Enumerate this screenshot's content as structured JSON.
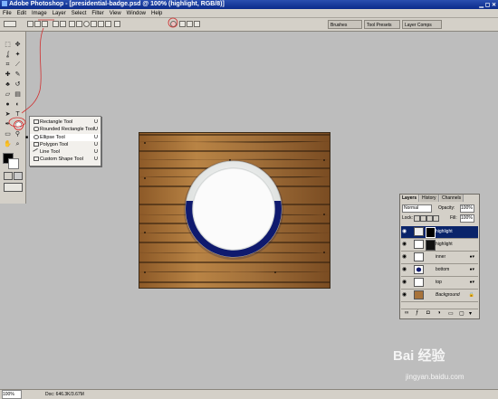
{
  "window": {
    "title": "Adobe Photoshop - [presidential-badge.psd @ 100% (highlight, RGB/8)]"
  },
  "menu": [
    "File",
    "Edit",
    "Image",
    "Layer",
    "Select",
    "Filter",
    "View",
    "Window",
    "Help"
  ],
  "options": {
    "palette_tabs": [
      "Brushes",
      "Tool Presets",
      "Layer Comps"
    ]
  },
  "shape_menu": {
    "items": [
      {
        "label": "Rectangle Tool",
        "key": "U",
        "selected": false
      },
      {
        "label": "Rounded Rectangle Tool",
        "key": "U",
        "selected": false
      },
      {
        "label": "Ellipse Tool",
        "key": "U",
        "selected": true
      },
      {
        "label": "Polygon Tool",
        "key": "U",
        "selected": false
      },
      {
        "label": "Line Tool",
        "key": "U",
        "selected": false
      },
      {
        "label": "Custom Shape Tool",
        "key": "U",
        "selected": false
      }
    ]
  },
  "layers_panel": {
    "tabs": [
      "Layers",
      "History",
      "Channels"
    ],
    "blend_mode": "Normal",
    "opacity_label": "Opacity:",
    "opacity": "100%",
    "lock_label": "Lock:",
    "fill_label": "Fill:",
    "fill": "100%",
    "layers": [
      {
        "name": "highlight",
        "selected": true,
        "has_fx": false
      },
      {
        "name": "highlight",
        "selected": false,
        "has_fx": false
      },
      {
        "name": "inner",
        "selected": false,
        "has_fx": true
      },
      {
        "name": "bottom",
        "selected": false,
        "has_fx": true
      },
      {
        "name": "top",
        "selected": false,
        "has_fx": true
      },
      {
        "name": "Background",
        "selected": false,
        "has_fx": false
      }
    ]
  },
  "statusbar": {
    "zoom": "100%",
    "doc": "Doc: 646.3K/3.67M"
  },
  "watermark": {
    "brand": "Bai 经验",
    "url": "jingyan.baidu.com"
  },
  "colors": {
    "navy": "#0f1a6e",
    "wood": "#a8733a",
    "title_blue": "#0a2a8a",
    "annotation_red": "#d03030"
  }
}
